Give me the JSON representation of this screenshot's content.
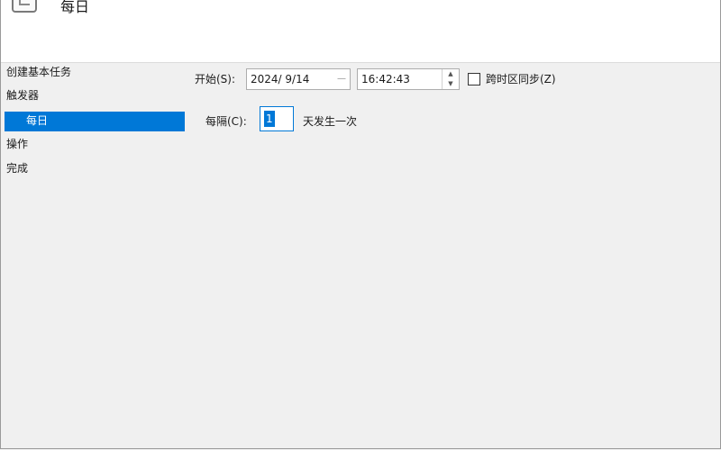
{
  "header": {
    "title": "每日",
    "icon": "task-scheduler-icon"
  },
  "nav": {
    "items": [
      {
        "label": "创建基本任务",
        "selected": false
      },
      {
        "label": "触发器",
        "selected": false
      },
      {
        "label": "每日",
        "selected": true
      },
      {
        "label": "操作",
        "selected": false
      },
      {
        "label": "完成",
        "selected": false
      }
    ]
  },
  "trigger": {
    "start_label": "开始(S):",
    "start_date": "2024/  9/14",
    "start_time": "16:42:43",
    "sync_timezone_label": "跨时区同步(Z)",
    "sync_timezone_checked": false,
    "recur_label": "每隔(C):",
    "recur_value": "1",
    "recur_suffix": "天发生一次"
  },
  "colors": {
    "selection": "#0078d7"
  }
}
